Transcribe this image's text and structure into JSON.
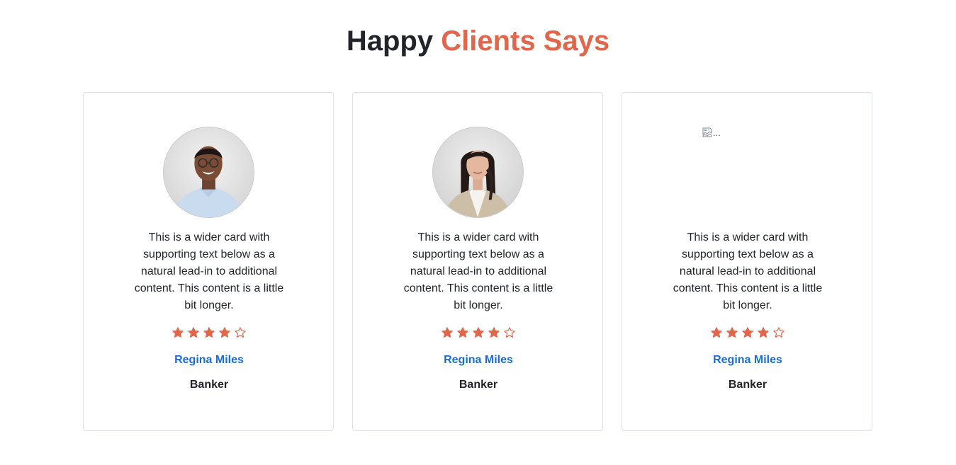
{
  "heading": {
    "part1": "Happy",
    "part2": "Clients Says"
  },
  "colors": {
    "accent": "#e0664c",
    "heading_dark": "#222429",
    "name_link": "#1a6dd6",
    "card_border": "#dee2e6"
  },
  "testimonials": [
    {
      "image": "photo",
      "avatar_icon": "man-portrait",
      "text": "This is a wider card with supporting text below as a natural lead-in to additional content. This content is a little bit longer.",
      "rating": 4,
      "rating_max": 5,
      "name": "Regina Miles",
      "role": "Banker"
    },
    {
      "image": "photo",
      "avatar_icon": "woman-portrait",
      "text": "This is a wider card with supporting text below as a natural lead-in to additional content. This content is a little bit longer.",
      "rating": 4,
      "rating_max": 5,
      "name": "Regina Miles",
      "role": "Banker"
    },
    {
      "image": "broken",
      "alt_text": "...",
      "text": "This is a wider card with supporting text below as a natural lead-in to additional content. This content is a little bit longer.",
      "rating": 4,
      "rating_max": 5,
      "name": "Regina Miles",
      "role": "Banker"
    }
  ]
}
